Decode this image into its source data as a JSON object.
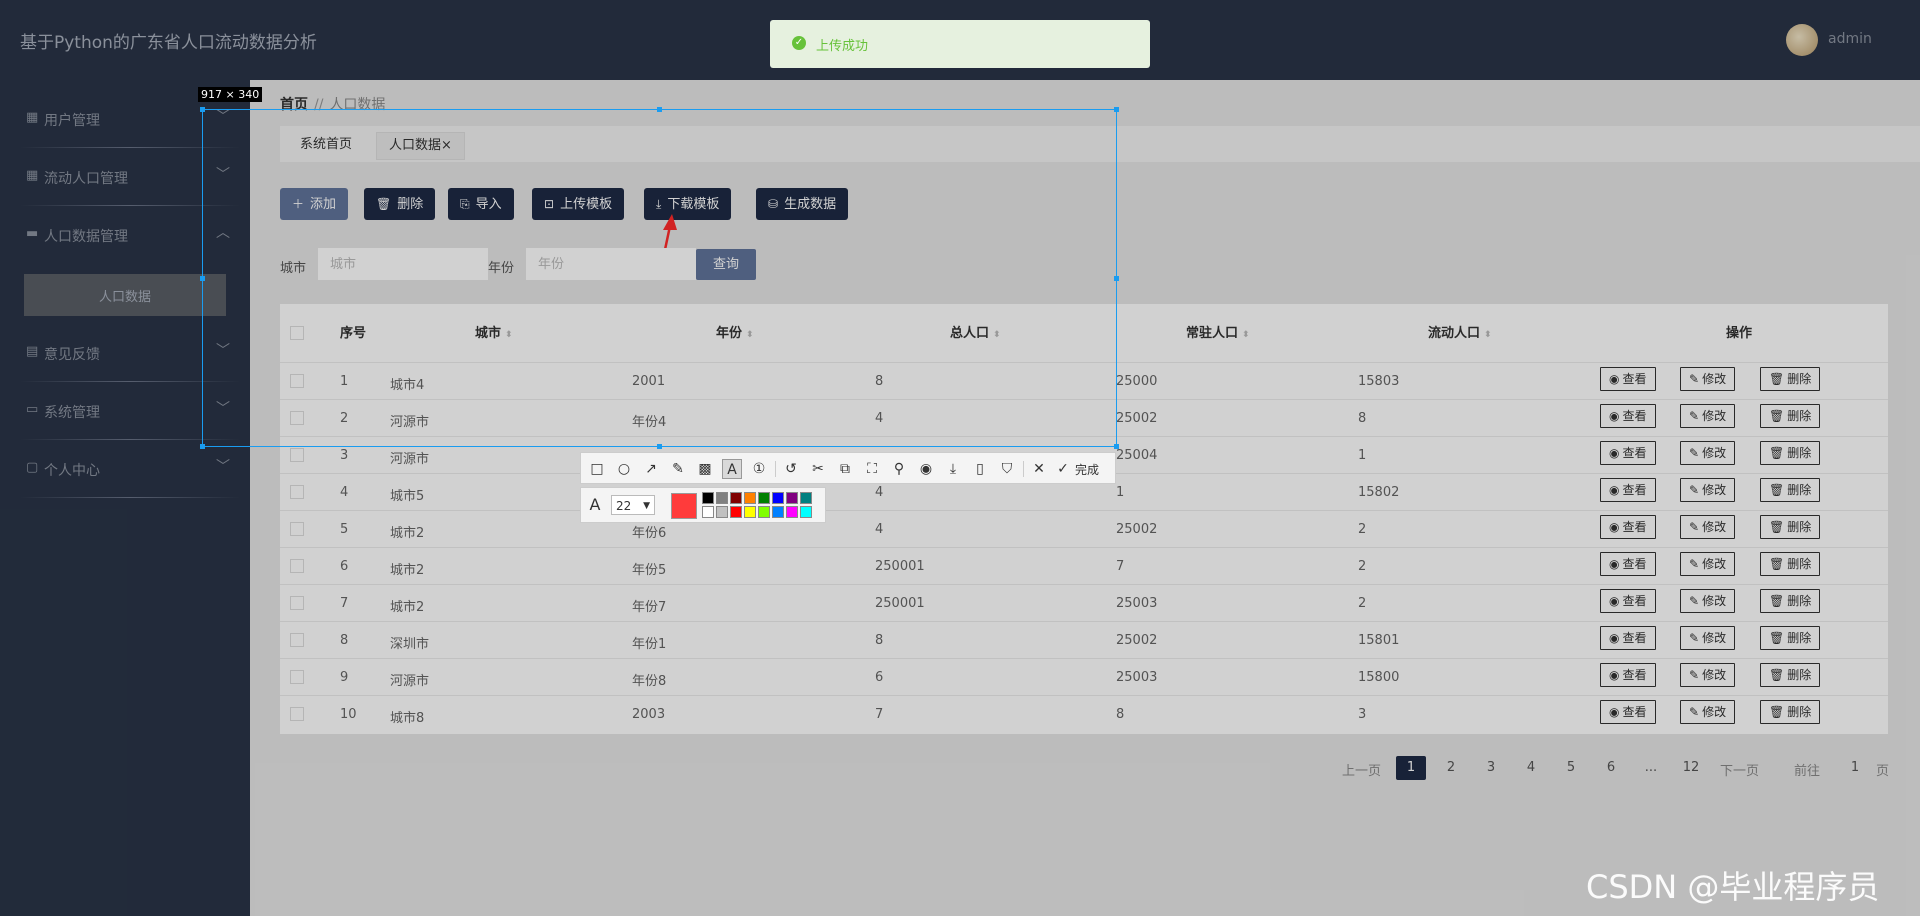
{
  "app_title": "基于Python的广东省人口流动数据分析",
  "user": {
    "name": "admin"
  },
  "toast": {
    "text": "上传成功"
  },
  "sidebar": {
    "items": [
      {
        "label": "用户管理",
        "icon": "grid-icon",
        "chevron": "﹀"
      },
      {
        "label": "流动人口管理",
        "icon": "grid-icon",
        "chevron": "﹀"
      },
      {
        "label": "人口数据管理",
        "icon": "folder-icon",
        "chevron": "︿"
      },
      {
        "label": "意见反馈",
        "icon": "clipboard-icon",
        "chevron": "﹀"
      },
      {
        "label": "系统管理",
        "icon": "monitor-icon",
        "chevron": "﹀"
      },
      {
        "label": "个人中心",
        "icon": "window-icon",
        "chevron": "﹀"
      }
    ],
    "sub_item": "人口数据"
  },
  "breadcrumb": {
    "home": "首页",
    "sep": "//",
    "current": "人口数据"
  },
  "tabs": [
    {
      "label": "系统首页"
    },
    {
      "label": "人口数据",
      "close": "×"
    }
  ],
  "toolbar": {
    "add": "添加",
    "delete": "删除",
    "import": "导入",
    "upload_template": "上传模板",
    "download_template": "下载模板",
    "generate": "生成数据"
  },
  "filter": {
    "city_label": "城市",
    "city_placeholder": "城市",
    "year_label": "年份",
    "year_placeholder": "年份",
    "query": "查询"
  },
  "table": {
    "headers": {
      "index": "序号",
      "city": "城市",
      "year": "年份",
      "total": "总人口",
      "resident": "常驻人口",
      "floating": "流动人口",
      "actions": "操作"
    },
    "actions": {
      "view": "查看",
      "edit": "修改",
      "delete": "删除"
    },
    "rows": [
      {
        "index": "1",
        "city": "城市4",
        "year": "2001",
        "total": "8",
        "resident": "25000",
        "floating": "15803"
      },
      {
        "index": "2",
        "city": "河源市",
        "year": "年份4",
        "total": "4",
        "resident": "25002",
        "floating": "8"
      },
      {
        "index": "3",
        "city": "河源市",
        "year": "",
        "total": "",
        "resident": "25004",
        "floating": "1"
      },
      {
        "index": "4",
        "city": "城市5",
        "year": "",
        "total": "4",
        "resident": "1",
        "floating": "15802"
      },
      {
        "index": "5",
        "city": "城市2",
        "year": "年份6",
        "total": "4",
        "resident": "25002",
        "floating": "2"
      },
      {
        "index": "6",
        "city": "城市2",
        "year": "年份5",
        "total": "250001",
        "resident": "7",
        "floating": "2"
      },
      {
        "index": "7",
        "city": "城市2",
        "year": "年份7",
        "total": "250001",
        "resident": "25003",
        "floating": "2"
      },
      {
        "index": "8",
        "city": "深圳市",
        "year": "年份1",
        "total": "8",
        "resident": "25002",
        "floating": "15801"
      },
      {
        "index": "9",
        "city": "河源市",
        "year": "年份8",
        "total": "6",
        "resident": "25003",
        "floating": "15800"
      },
      {
        "index": "10",
        "city": "城市8",
        "year": "2003",
        "total": "7",
        "resident": "8",
        "floating": "3"
      }
    ]
  },
  "pagination": {
    "prev": "上一页",
    "next": "下一页",
    "goto": "前往",
    "goto_value": "1",
    "page_unit": "页",
    "pages": [
      "1",
      "2",
      "3",
      "4",
      "5",
      "6",
      "...",
      "12"
    ],
    "current": "1"
  },
  "screenshot_tool": {
    "size_label": "917 × 340",
    "done": "完成",
    "font_size": "22",
    "current_color": "#ff3b3b",
    "palette_top": [
      "#000000",
      "#808080",
      "#800000",
      "#ff8000",
      "#008000",
      "#0000ff",
      "#800080",
      "#008080"
    ],
    "palette_bottom": [
      "#ffffff",
      "#c0c0c0",
      "#ff0000",
      "#ffff00",
      "#80ff00",
      "#0080ff",
      "#ff00ff",
      "#00ffff"
    ]
  },
  "watermark": "CSDN @毕业程序员"
}
